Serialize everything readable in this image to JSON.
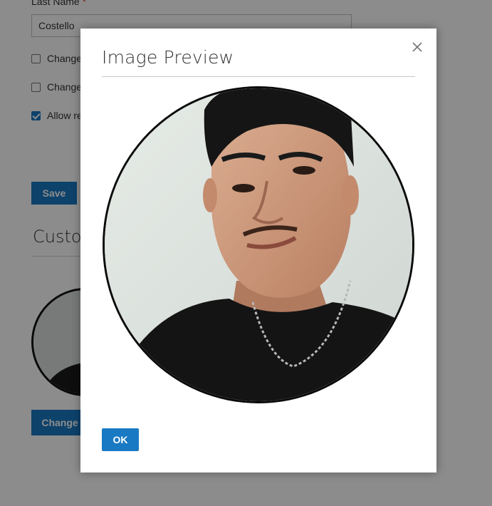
{
  "form": {
    "last_name_label": "Last Name",
    "required_mark": "*",
    "last_name_value": "Costello",
    "checkboxes": [
      {
        "label": "Change",
        "checked": false
      },
      {
        "label": "Change",
        "checked": false
      },
      {
        "label": "Allow re",
        "checked": true
      }
    ],
    "save_label": "Save",
    "section_title": "Custom",
    "change_button_label": "Change"
  },
  "modal": {
    "title": "Image Preview",
    "ok_label": "OK",
    "close_icon": "close-icon"
  },
  "colors": {
    "primary": "#1979c3",
    "overlay": "rgba(0,0,0,0.45)"
  }
}
